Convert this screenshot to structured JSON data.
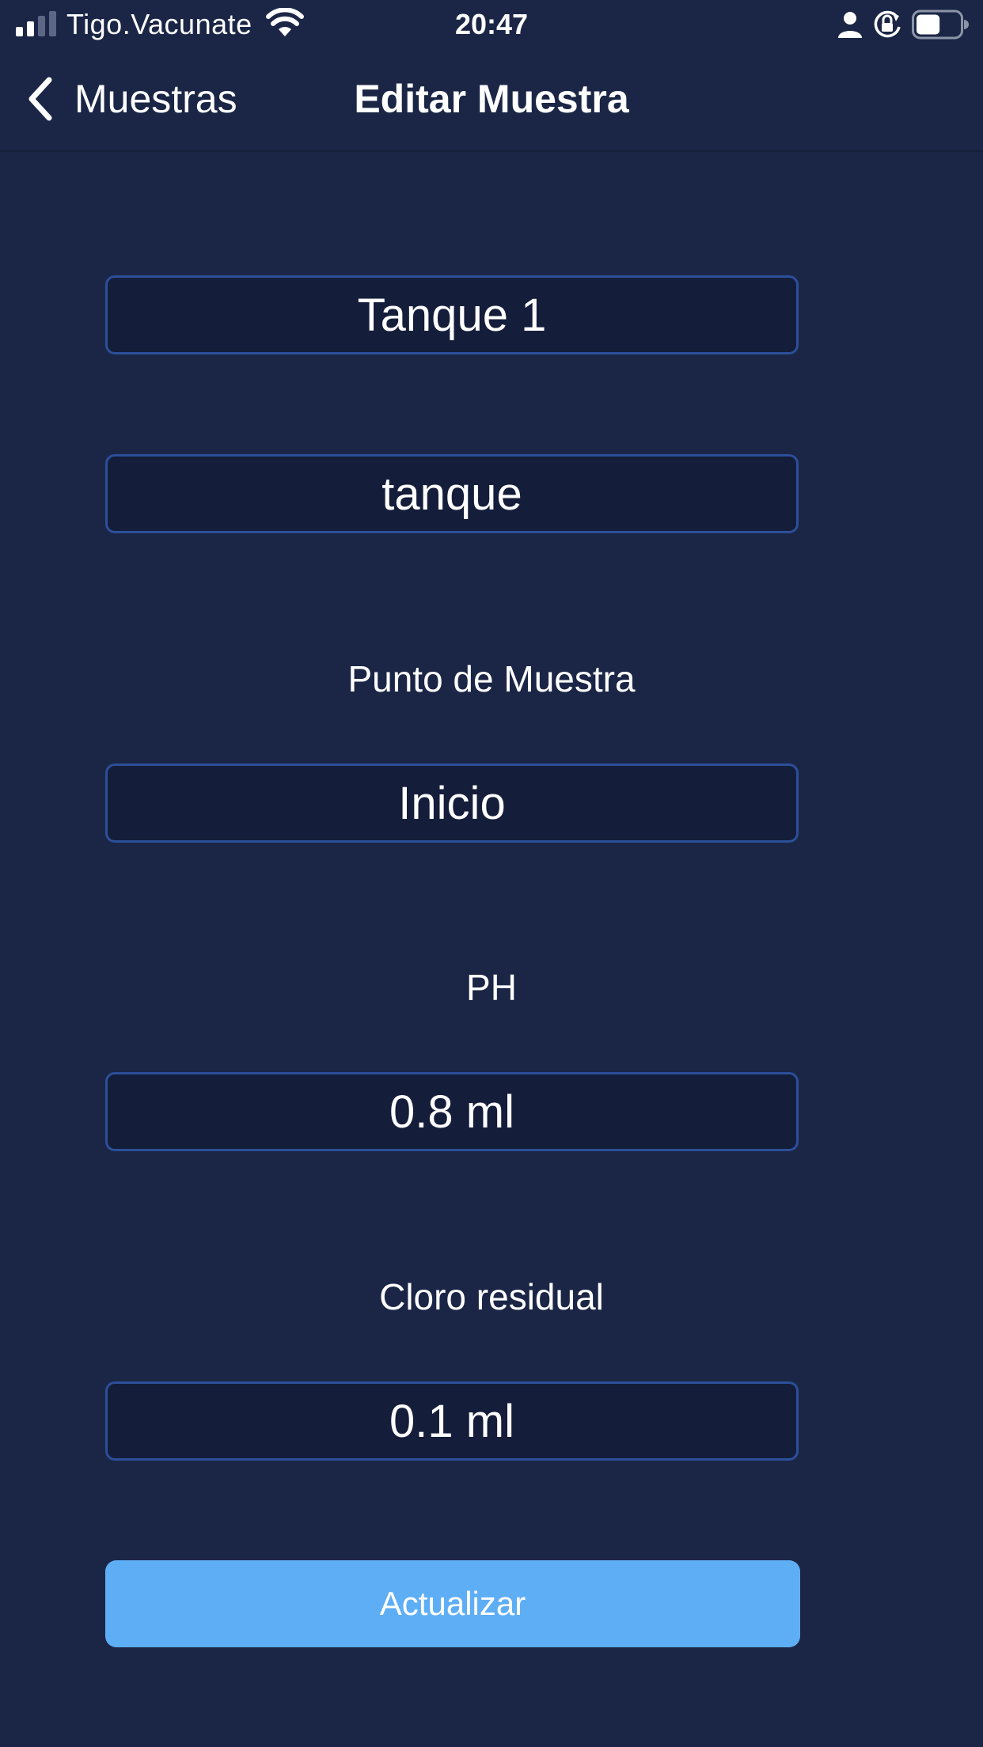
{
  "status_bar": {
    "carrier": "Tigo.Vacunate",
    "time": "20:47",
    "battery_level": 0.55,
    "icons": [
      "signal-icon",
      "wifi-icon",
      "person-icon",
      "rotation-lock-icon",
      "battery-icon"
    ]
  },
  "nav": {
    "back_label": "Muestras",
    "title": "Editar Muestra"
  },
  "form": {
    "name_value": "Tanque 1",
    "type_value": "tanque",
    "sample_point_label": "Punto de Muestra",
    "sample_point_value": "Inicio",
    "ph_label": "PH",
    "ph_value": "0.8 ml",
    "chlorine_label": "Cloro residual",
    "chlorine_value": "0.1 ml",
    "submit_label": "Actualizar"
  },
  "colors": {
    "background": "#1b2646",
    "field_background": "#141d3a",
    "field_border": "#2c4f9a",
    "button": "#5eaef6"
  }
}
